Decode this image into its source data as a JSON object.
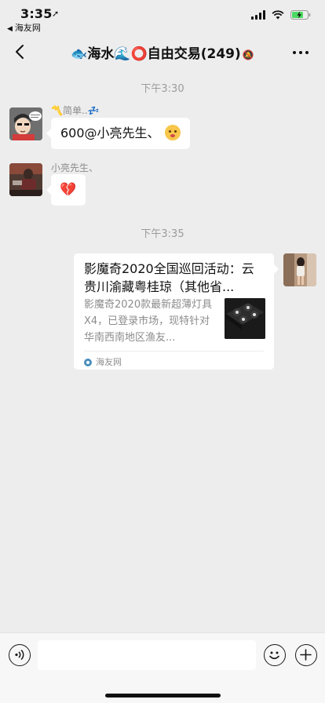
{
  "status_bar": {
    "time": "3:35",
    "location_arrow": "➚",
    "back_app": "海友网",
    "back_triangle": "◀"
  },
  "nav": {
    "title": "🐟海水🌊⭕自由交易(249)",
    "mute_icon": "🔕"
  },
  "messages": {
    "time_1": "下午3:30",
    "msg1_sender": "〽️简单..💤",
    "msg1_text": "600@小亮先生、",
    "msg2_sender": "小亮先生、",
    "msg2_text": "💔",
    "time_2": "下午3:35"
  },
  "card": {
    "title": "影魔奇2020全国巡回活动：云贵川渝藏粤桂琼（其他省...",
    "description": "影魔奇2020款最新超薄灯具X4，已登录市场，现特针对华南西南地区渔友...",
    "source": "海友网"
  },
  "input": {
    "value": ""
  },
  "colors": {
    "background": "#ededed",
    "bubble": "#ffffff",
    "meta_text": "#9b9b9b"
  }
}
